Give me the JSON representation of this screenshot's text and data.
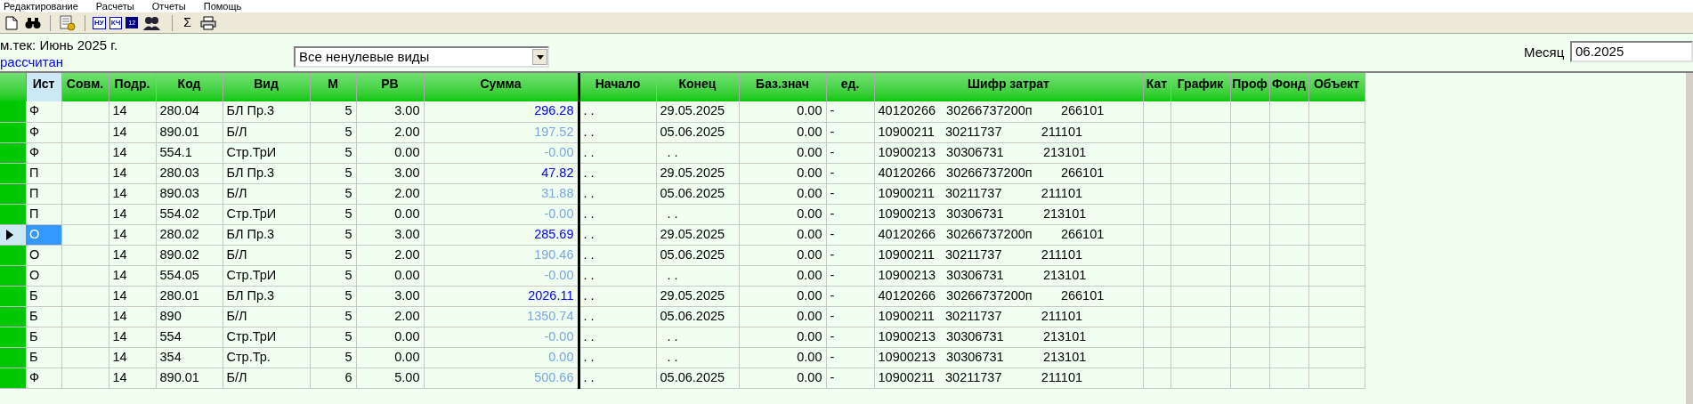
{
  "menu": [
    "Редактирование",
    "Расчеты",
    "Отчеты",
    "Помощь"
  ],
  "toolbar": [
    {
      "kind": "new"
    },
    {
      "kind": "find"
    },
    {
      "kind": "sep"
    },
    {
      "kind": "gear"
    },
    {
      "kind": "sep"
    },
    {
      "kind": "tag",
      "label": "НУ"
    },
    {
      "kind": "tag",
      "label": "КЧ"
    },
    {
      "kind": "calendar",
      "label": "12"
    },
    {
      "kind": "people"
    },
    {
      "kind": "sep"
    },
    {
      "kind": "glyph",
      "label": "Σ"
    },
    {
      "kind": "print"
    }
  ],
  "info": {
    "period": "м.тек: Июнь 2025 г.",
    "status": "рассчитан"
  },
  "filter": {
    "value": "Все ненулевые виды"
  },
  "month": {
    "label": "Месяц",
    "value": "06.2025"
  },
  "table": {
    "columns": [
      "Ист",
      "Совм.",
      "Подр.",
      "Код",
      "Вид",
      "М",
      "РВ",
      "Сумма",
      "Начало",
      "Конец",
      "Баз.знач",
      "ед.",
      "Шифр затрат",
      "Кат",
      "График",
      "Проф",
      "Фонд",
      "Объект"
    ],
    "rows": [
      {
        "selected": false,
        "sum_strong": true,
        "cells": [
          "Ф",
          "",
          "14",
          "280.04",
          "БЛ Пр.3",
          "5",
          "3.00",
          "296.28",
          ". .",
          "29.05.2025",
          "0.00",
          "-",
          "40120266   30266737200п        266101",
          "",
          "",
          "",
          "",
          ""
        ]
      },
      {
        "selected": false,
        "sum_strong": false,
        "cells": [
          "Ф",
          "",
          "14",
          "890.01",
          "Б/Л",
          "5",
          "2.00",
          "197.52",
          ". .",
          "05.06.2025",
          "0.00",
          "-",
          "10900211   30211737           211101",
          "",
          "",
          "",
          "",
          ""
        ]
      },
      {
        "selected": false,
        "sum_strong": false,
        "cells": [
          "Ф",
          "",
          "14",
          "554.1",
          "Стр.ТрИ",
          "5",
          "0.00",
          "-0.00",
          ". .",
          "  . .",
          "0.00",
          "-",
          "10900213   30306731           213101",
          "",
          "",
          "",
          "",
          ""
        ]
      },
      {
        "selected": false,
        "sum_strong": true,
        "cells": [
          "П",
          "",
          "14",
          "280.03",
          "БЛ Пр.3",
          "5",
          "3.00",
          "47.82",
          ". .",
          "29.05.2025",
          "0.00",
          "-",
          "40120266   30266737200п        266101",
          "",
          "",
          "",
          "",
          ""
        ]
      },
      {
        "selected": false,
        "sum_strong": false,
        "cells": [
          "П",
          "",
          "14",
          "890.03",
          "Б/Л",
          "5",
          "2.00",
          "31.88",
          ". .",
          "05.06.2025",
          "0.00",
          "-",
          "10900211   30211737           211101",
          "",
          "",
          "",
          "",
          ""
        ]
      },
      {
        "selected": false,
        "sum_strong": false,
        "cells": [
          "П",
          "",
          "14",
          "554.02",
          "Стр.ТрИ",
          "5",
          "0.00",
          "-0.00",
          ". .",
          "  . .",
          "0.00",
          "-",
          "10900213   30306731           213101",
          "",
          "",
          "",
          "",
          ""
        ]
      },
      {
        "selected": true,
        "sum_strong": true,
        "cells": [
          "О",
          "",
          "14",
          "280.02",
          "БЛ Пр.3",
          "5",
          "3.00",
          "285.69",
          ". .",
          "29.05.2025",
          "0.00",
          "-",
          "40120266   30266737200п        266101",
          "",
          "",
          "",
          "",
          ""
        ]
      },
      {
        "selected": false,
        "sum_strong": false,
        "cells": [
          "О",
          "",
          "14",
          "890.02",
          "Б/Л",
          "5",
          "2.00",
          "190.46",
          ". .",
          "05.06.2025",
          "0.00",
          "-",
          "10900211   30211737           211101",
          "",
          "",
          "",
          "",
          ""
        ]
      },
      {
        "selected": false,
        "sum_strong": false,
        "cells": [
          "О",
          "",
          "14",
          "554.05",
          "Стр.ТрИ",
          "5",
          "0.00",
          "-0.00",
          ". .",
          "  . .",
          "0.00",
          "-",
          "10900213   30306731           213101",
          "",
          "",
          "",
          "",
          ""
        ]
      },
      {
        "selected": false,
        "sum_strong": true,
        "cells": [
          "Б",
          "",
          "14",
          "280.01",
          "БЛ Пр.3",
          "5",
          "3.00",
          "2026.11",
          ". .",
          "29.05.2025",
          "0.00",
          "-",
          "40120266   30266737200п        266101",
          "",
          "",
          "",
          "",
          ""
        ]
      },
      {
        "selected": false,
        "sum_strong": false,
        "cells": [
          "Б",
          "",
          "14",
          "890",
          "Б/Л",
          "5",
          "2.00",
          "1350.74",
          ". .",
          "05.06.2025",
          "0.00",
          "-",
          "10900211   30211737           211101",
          "",
          "",
          "",
          "",
          ""
        ]
      },
      {
        "selected": false,
        "sum_strong": false,
        "cells": [
          "Б",
          "",
          "14",
          "554",
          "Стр.ТрИ",
          "5",
          "0.00",
          "-0.00",
          ". .",
          "  . .",
          "0.00",
          "-",
          "10900213   30306731           213101",
          "",
          "",
          "",
          "",
          ""
        ]
      },
      {
        "selected": false,
        "sum_strong": false,
        "cells": [
          "Б",
          "",
          "14",
          "354",
          "Стр.Тр.",
          "5",
          "0.00",
          "0.00",
          ". .",
          "  . .",
          "0.00",
          "-",
          "10900213   30306731           213101",
          "",
          "",
          "",
          "",
          ""
        ]
      },
      {
        "selected": false,
        "sum_strong": false,
        "cells": [
          "Ф",
          "",
          "14",
          "890.01",
          "Б/Л",
          "6",
          "5.00",
          "500.66",
          ". .",
          "05.06.2025",
          "0.00",
          "-",
          "10900211   30211737           211101",
          "",
          "",
          "",
          "",
          ""
        ]
      }
    ]
  }
}
